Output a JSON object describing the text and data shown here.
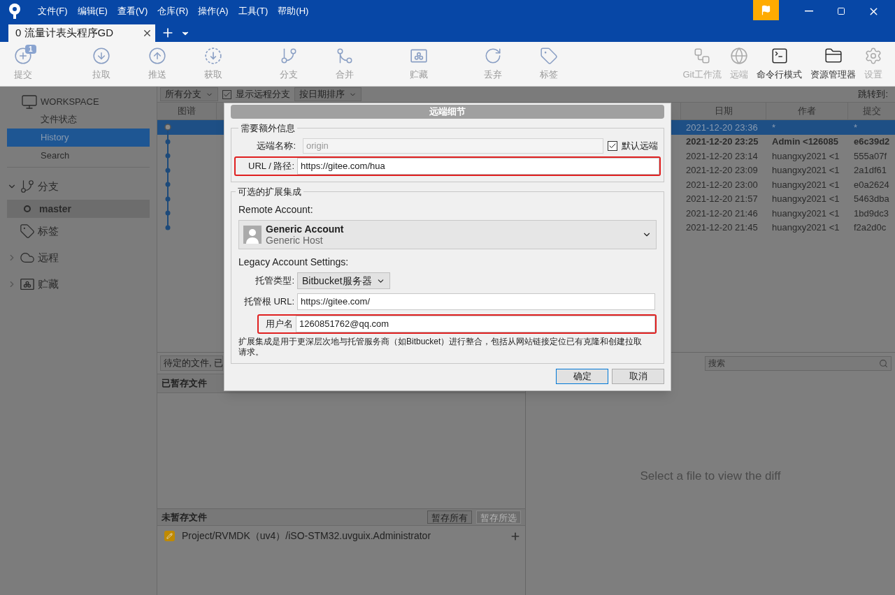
{
  "menu": [
    "文件(F)",
    "编辑(E)",
    "查看(V)",
    "仓库(R)",
    "操作(A)",
    "工具(T)",
    "帮助(H)"
  ],
  "tabs": [
    {
      "label": "0 流量计表头程序GD",
      "selected": true
    }
  ],
  "toolbar": {
    "left": [
      {
        "label": "提交",
        "badge": "1"
      },
      {
        "label": "拉取"
      },
      {
        "label": "推送"
      },
      {
        "label": "获取"
      },
      {
        "label": "分支"
      },
      {
        "label": "合并"
      },
      {
        "label": "贮藏"
      },
      {
        "label": "丢弃"
      },
      {
        "label": "标签"
      }
    ],
    "right": [
      {
        "label": "Git工作流",
        "disabled": true
      },
      {
        "label": "远端",
        "disabled": true
      },
      {
        "label": "命令行模式",
        "disabled": false
      },
      {
        "label": "资源管理器",
        "disabled": false
      },
      {
        "label": "设置",
        "disabled": true
      }
    ]
  },
  "sidebar": {
    "workspace": "WORKSPACE",
    "items": [
      {
        "label": "文件状态",
        "selected": false
      },
      {
        "label": "History",
        "selected": true
      },
      {
        "label": "Search",
        "selected": false
      }
    ],
    "groups": [
      {
        "label": "分支",
        "expanded": true,
        "children": [
          {
            "label": "master",
            "selected": true
          }
        ]
      },
      {
        "label": "标签"
      },
      {
        "label": "远程",
        "expanded": false
      },
      {
        "label": "贮藏",
        "expanded": false
      }
    ]
  },
  "history": {
    "branch_filter": "所有分支",
    "show_remote": {
      "label": "显示远程分支",
      "checked": true
    },
    "sort": "按日期排序",
    "jump_label": "跳转到:",
    "columns": [
      "图谱",
      "日期",
      "作者",
      "提交"
    ],
    "rows": [
      {
        "kind": "uncommitted",
        "date": "2021-12-20 23:36",
        "author": "*",
        "commit": "*",
        "selected": true,
        "bold": false
      },
      {
        "kind": "commit",
        "date": "2021-12-20 23:25",
        "author": "Admin <126085",
        "commit": "e6c39d2",
        "selected": false,
        "bold": true
      },
      {
        "kind": "commit",
        "date": "2021-12-20 23:14",
        "author": "huangxy2021 <1",
        "commit": "555a07f",
        "selected": false,
        "bold": false
      },
      {
        "kind": "commit",
        "date": "2021-12-20 23:09",
        "author": "huangxy2021 <1",
        "commit": "2a1df61",
        "selected": false,
        "bold": false
      },
      {
        "kind": "commit",
        "date": "2021-12-20 23:00",
        "author": "huangxy2021 <1",
        "commit": "e0a2624",
        "selected": false,
        "bold": false
      },
      {
        "kind": "commit",
        "date": "2021-12-20 21:57",
        "author": "huangxy2021 <1",
        "commit": "5463dba",
        "selected": false,
        "bold": false
      },
      {
        "kind": "commit",
        "date": "2021-12-20 21:46",
        "author": "huangxy2021 <1",
        "commit": "1bd9dc3",
        "selected": false,
        "bold": false
      },
      {
        "kind": "commit",
        "date": "2021-12-20 21:45",
        "author": "huangxy2021 <1",
        "commit": "f2a2d0c",
        "selected": false,
        "bold": false
      }
    ]
  },
  "pending": {
    "filter": "待定的文件, 已",
    "staged_title": "已暂存文件",
    "unstaged_title": "未暂存文件",
    "buttons": [
      {
        "label": "暂存所有",
        "disabled": false
      },
      {
        "label": "暂存所选",
        "disabled": true
      }
    ],
    "files": [
      {
        "path": "Project/RVMDK（uv4）/iSO-STM32.uvguix.Administrator"
      }
    ]
  },
  "diff": {
    "search_placeholder": "搜索",
    "empty": "Select a file to view the diff"
  },
  "dialog": {
    "title": "远端细节",
    "required": {
      "legend": "需要额外信息",
      "remote_name": {
        "label": "远端名称:",
        "value": "origin",
        "disabled": true
      },
      "default_remote": {
        "label": "默认远端",
        "checked": true
      },
      "url": {
        "label": "URL / 路径:",
        "value": "https://gitee.com/hua",
        "highlighted": true
      }
    },
    "optional": {
      "legend": "可选的扩展集成",
      "account_label": "Remote Account:",
      "account": {
        "name": "Generic Account",
        "host": "Generic Host"
      },
      "legacy_label": "Legacy Account Settings:",
      "host_type": {
        "label": "托管类型:",
        "value": "Bitbucket服务器"
      },
      "host_url": {
        "label": "托管根 URL:",
        "value": "https://gitee.com/",
        "highlighted": false
      },
      "username": {
        "label": "用户名",
        "value": "1260851762@qq.com",
        "highlighted": true
      },
      "note": "扩展集成是用于更深层次地与托管服务商（如Bitbucket）进行整合，包括从网站链接定位已有克隆和创建拉取请求。"
    },
    "buttons": [
      {
        "label": "确定",
        "default": true
      },
      {
        "label": "取消",
        "default": false
      }
    ]
  }
}
